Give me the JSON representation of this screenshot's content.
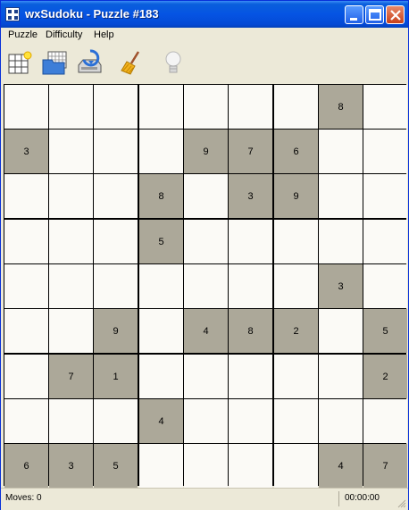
{
  "window": {
    "title": "wxSudoku - Puzzle #183"
  },
  "menu": [
    "Puzzle",
    "Difficulty",
    "Help"
  ],
  "toolbar": {
    "icons": [
      "new-puzzle-icon",
      "open-folder-icon",
      "save-disk-icon",
      "clear-broom-icon",
      "hint-lightbulb-icon"
    ]
  },
  "grid": [
    [
      "",
      "",
      "",
      "",
      "",
      "",
      "",
      "8",
      ""
    ],
    [
      "3",
      "",
      "",
      "",
      "9",
      "7",
      "6",
      "",
      ""
    ],
    [
      "",
      "",
      "",
      "8",
      "",
      "3",
      "9",
      "",
      ""
    ],
    [
      "",
      "",
      "",
      "5",
      "",
      "",
      "",
      "",
      ""
    ],
    [
      "",
      "",
      "",
      "",
      "",
      "",
      "",
      "3",
      ""
    ],
    [
      "",
      "",
      "9",
      "",
      "4",
      "8",
      "2",
      "",
      "5"
    ],
    [
      "",
      "7",
      "1",
      "",
      "",
      "",
      "",
      "",
      "2"
    ],
    [
      "",
      "",
      "",
      "4",
      "",
      "",
      "",
      "",
      ""
    ],
    [
      "6",
      "3",
      "5",
      "",
      "",
      "",
      "",
      "4",
      "7"
    ]
  ],
  "status": {
    "moves": "Moves: 0",
    "time": "00:00:00"
  },
  "colors": {
    "given_cell": "#aca899",
    "empty_cell": "#fbfaf6",
    "titlebar": "#0554e3"
  }
}
